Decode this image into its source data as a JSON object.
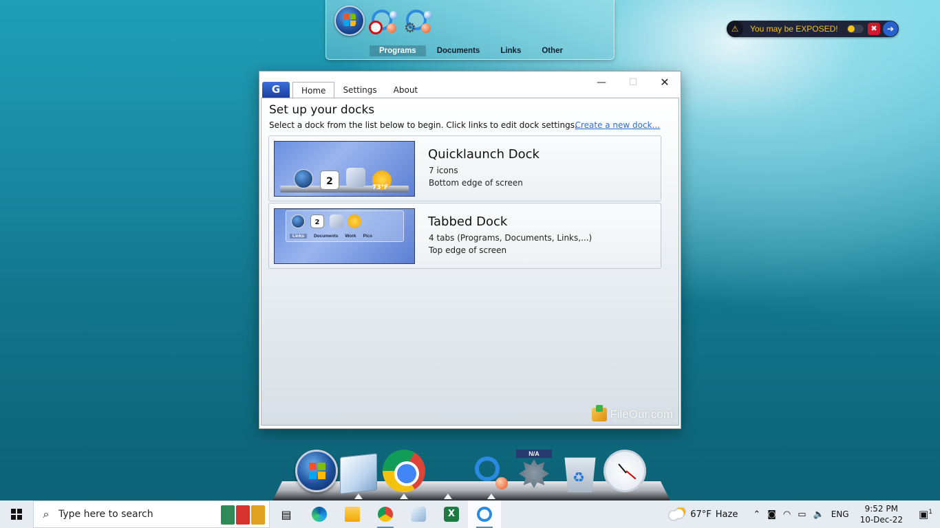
{
  "top_dock": {
    "tabs": [
      {
        "label": "Programs",
        "active": true
      },
      {
        "label": "Documents",
        "active": false
      },
      {
        "label": "Links",
        "active": false
      },
      {
        "label": "Other",
        "active": false
      }
    ]
  },
  "exposed_widget": {
    "text": "You may be EXPOSED!"
  },
  "window": {
    "tabs": [
      {
        "label": "Home",
        "active": true
      },
      {
        "label": "Settings",
        "active": false
      },
      {
        "label": "About",
        "active": false
      }
    ],
    "heading": "Set up your docks",
    "subtitle": "Select a dock from the list below to begin. Click links to edit dock settings.",
    "create_link": "Create a new dock...",
    "docks": [
      {
        "title": "Quicklaunch Dock",
        "line1": "7 icons",
        "line2": "Bottom edge of screen",
        "thumb_temp": "73°F"
      },
      {
        "title": "Tabbed Dock",
        "line1": "4 tabs (Programs, Documents, Links,...)",
        "line2": "Top edge of screen",
        "thumb_tabs": [
          "Links",
          "Documents",
          "Work",
          "Pics"
        ]
      }
    ],
    "calendar_day": "2",
    "watermark": "FileOur.com"
  },
  "bottom_dock": {
    "na_label": "N/A"
  },
  "taskbar": {
    "search_placeholder": "Type here to search",
    "weather_temp": "67°F",
    "weather_desc": "Haze",
    "language": "ENG",
    "time": "9:52 PM",
    "date": "10-Dec-22",
    "notification_count": "1"
  },
  "colors": {
    "accent_link": "#2a6fd0",
    "exposed_text": "#f5c218",
    "exposed_bg": "#1f2438"
  }
}
